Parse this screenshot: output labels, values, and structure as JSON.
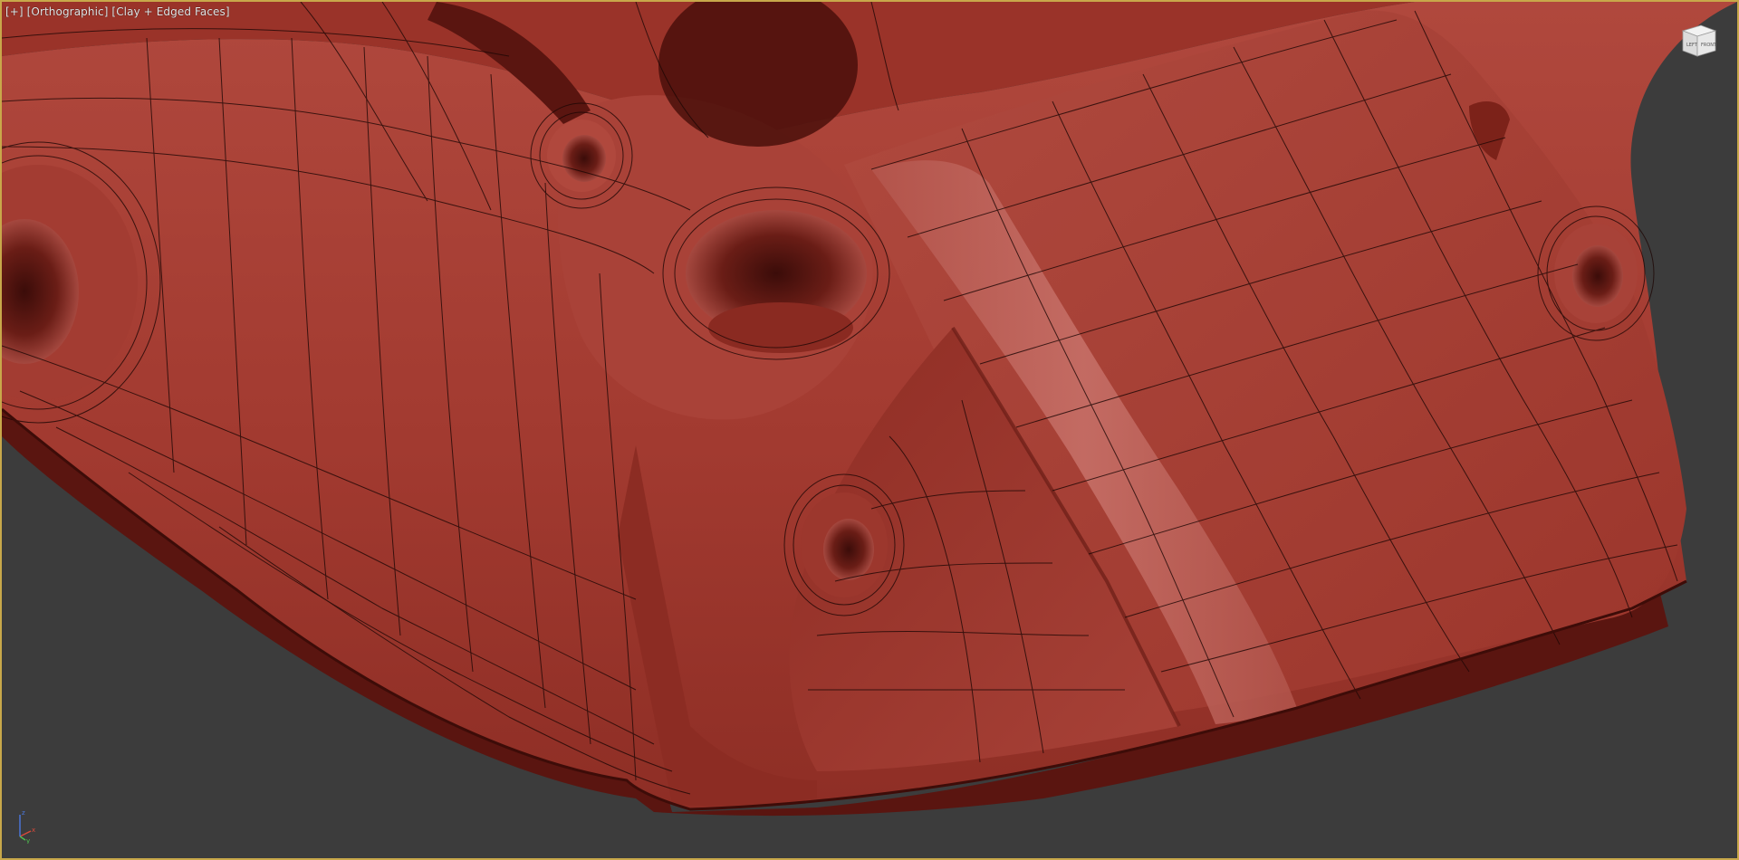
{
  "viewport": {
    "menu_label": "[+]",
    "view_label": "[Orthographic]",
    "shading_label": "[Clay + Edged Faces]"
  },
  "viewcube": {
    "icon": "viewcube-icon",
    "face_labels": [
      "LEFT",
      "FRONT"
    ]
  },
  "axis_tripod": {
    "icon": "axis-tripod-icon",
    "axes": [
      "x",
      "y",
      "z"
    ]
  },
  "colors": {
    "background": "#3c3c3c",
    "border": "#c8a84a",
    "clay": "#a33a30",
    "clay_dark": "#5e1712",
    "wire": "#1e0705",
    "highlight": "#c26a61"
  }
}
